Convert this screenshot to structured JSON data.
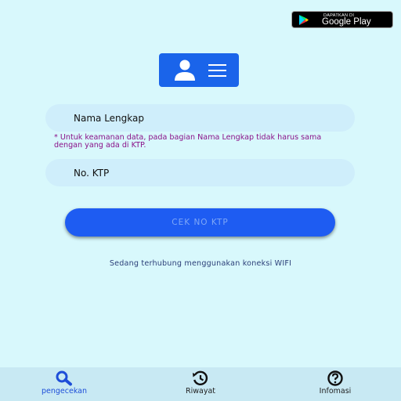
{
  "store_badge": {
    "small_text": "DAPATKAN DI",
    "big_text": "Google Play"
  },
  "form": {
    "name_placeholder": "Nama Lengkap",
    "note": "* Untuk keamanan data, pada bagian Nama Lengkap tidak harus sama dengan yang ada di KTP.",
    "ktp_placeholder": "No. KTP",
    "submit_label": "CEK NO KTP"
  },
  "status_text": "Sedang terhubung menggunakan koneksi WIFI",
  "bottom_nav": {
    "items": [
      {
        "label": "pengecekan",
        "icon": "search-icon",
        "active": true
      },
      {
        "label": "Riwayat",
        "icon": "history-icon",
        "active": false
      },
      {
        "label": "Infomasi",
        "icon": "help-icon",
        "active": false
      }
    ]
  },
  "colors": {
    "background": "#d8f8fc",
    "accent": "#1e5cf2",
    "input_bg": "#cfeefb",
    "note_text": "#8a1289",
    "nav_active": "#1e4ed8"
  }
}
